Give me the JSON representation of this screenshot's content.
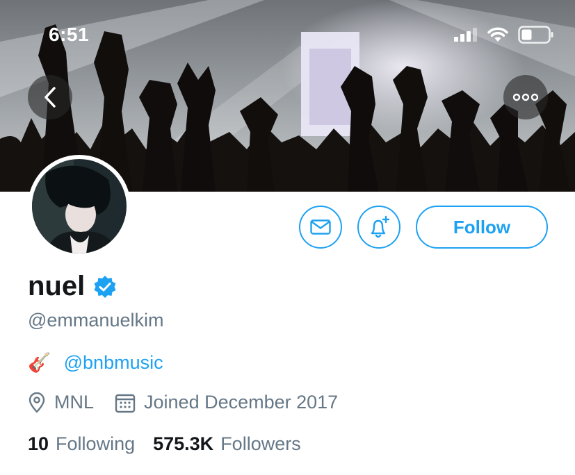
{
  "status_bar": {
    "time": "6:51"
  },
  "header": {
    "back_icon": "chevron-left-icon",
    "more_icon": "more-horizontal-icon"
  },
  "actions": {
    "message_icon": "envelope-icon",
    "notify_icon": "bell-plus-icon",
    "follow_label": "Follow"
  },
  "profile": {
    "name": "nuel",
    "verified": true,
    "handle": "@emmanuelkim",
    "bio_emoji": "🎸",
    "bio_link": "@bnbmusic",
    "location": "MNL",
    "joined": "Joined December 2017",
    "following_count": "10",
    "following_label": "Following",
    "followers_count": "575.3K",
    "followers_label": "Followers"
  },
  "colors": {
    "accent": "#1da1f2",
    "text": "#14171a",
    "muted": "#657786"
  }
}
